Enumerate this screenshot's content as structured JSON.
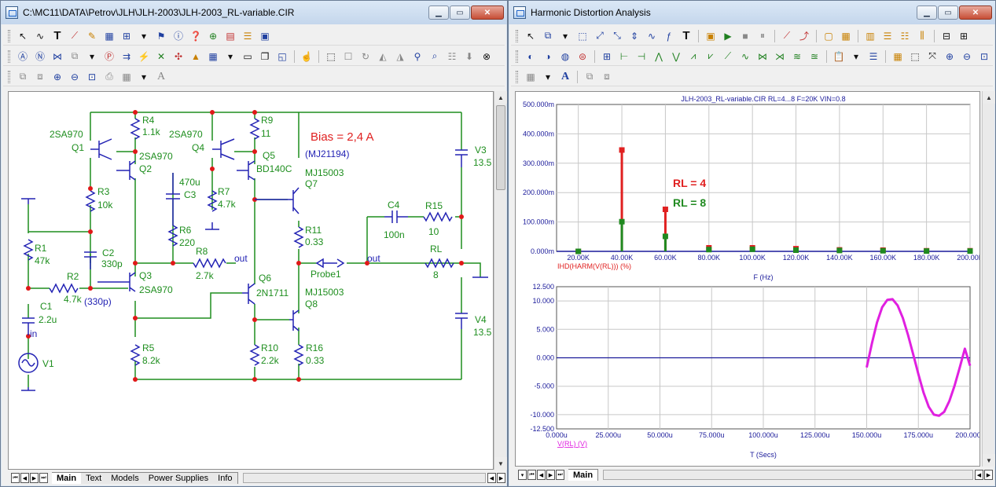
{
  "schematic_window": {
    "title": "C:\\MC11\\DATA\\Petrov\\JLH\\JLH-2003\\JLH-2003_RL-variable.CIR",
    "tabs": [
      {
        "label": "Main",
        "active": true
      },
      {
        "label": "Text",
        "active": false
      },
      {
        "label": "Models",
        "active": false
      },
      {
        "label": "Power Supplies",
        "active": false
      },
      {
        "label": "Info",
        "active": false
      }
    ],
    "bias_label": "Bias = 2,4 A",
    "components": {
      "r4": "R4",
      "r4v": "1.1k",
      "q1t": "2SA970",
      "q1": "Q1",
      "q2t": "2SA970",
      "q2": "Q2",
      "q4t": "2SA970",
      "q4": "Q4",
      "r9": "R9",
      "r9v": "11",
      "q5": "Q5",
      "q5t": "BD140C",
      "mj21194": "(MJ21194)",
      "q7t": "MJ15003",
      "q7": "Q7",
      "c3v": "470u",
      "c3": "C3",
      "r7": "R7",
      "r7v": "4.7k",
      "r3": "R3",
      "r3v": "10k",
      "r6": "R6",
      "r6v": "220",
      "v3": "V3",
      "v3v": "13.5",
      "c4": "C4",
      "c4v": "100n",
      "r15": "R15",
      "r15v": "10",
      "r11": "R11",
      "r11v": "0.33",
      "r1": "R1",
      "r1v": "47k",
      "c2": "C2",
      "c2v": "330p",
      "r8": "R8",
      "r8v": "2.7k",
      "out1": "out",
      "out2": "out",
      "rl": "RL",
      "rlv": "8",
      "probe": "Probe1",
      "r2": "R2",
      "r2v": "4.7k",
      "q3": "Q3",
      "q3t": "2SA970",
      "p330": "(330p)",
      "q6": "Q6",
      "q6t": "2N1711",
      "q8t": "MJ15003",
      "q8": "Q8",
      "c1": "C1",
      "c1v": "2.2u",
      "in": "in",
      "v4": "V4",
      "v4v": "13.5",
      "r5": "R5",
      "r5v": "8.2k",
      "r10": "R10",
      "r10v": "2.2k",
      "r16": "R16",
      "r16v": "0.33",
      "v1": "V1"
    }
  },
  "analysis_window": {
    "title": "Harmonic Distortion Analysis",
    "tabs": [
      {
        "label": "Main",
        "active": true
      }
    ]
  },
  "colors": {
    "red": "#e02020",
    "green": "#208a20",
    "magenta": "#e020e0",
    "axis": "#1a1a9a",
    "wire": "#1e8e1e",
    "symbol": "#2323b4"
  },
  "chart_data": [
    {
      "type": "bar",
      "title": "JLH-2003_RL-variable.CIR RL=4...8 F=20K VIN=0.8",
      "xlabel": "F (Hz)",
      "trace_label": "IHD(HARM(V(RL))) (%)",
      "xlim": [
        10000,
        200000
      ],
      "ylim": [
        0,
        0.5
      ],
      "x_ticks": [
        "20.00K",
        "40.00K",
        "60.00K",
        "80.00K",
        "100.00K",
        "120.00K",
        "140.00K",
        "160.00K",
        "180.00K",
        "200.00K"
      ],
      "y_ticks": [
        "0.000m",
        "100.000m",
        "200.000m",
        "300.000m",
        "400.000m",
        "500.000m"
      ],
      "annotations": [
        "RL = 4",
        "RL = 8"
      ],
      "grid": true,
      "series": [
        {
          "name": "RL = 4",
          "color": "#e02020",
          "x": [
            20000,
            40000,
            60000,
            80000,
            100000,
            120000,
            140000,
            160000,
            180000,
            200000
          ],
          "values": [
            0.0,
            0.345,
            0.143,
            0.012,
            0.012,
            0.009,
            0.005,
            0.004,
            0.002,
            0.002
          ]
        },
        {
          "name": "RL = 8",
          "color": "#208a20",
          "x": [
            20000,
            40000,
            60000,
            80000,
            100000,
            120000,
            140000,
            160000,
            180000,
            200000
          ],
          "values": [
            0.0,
            0.101,
            0.051,
            0.006,
            0.007,
            0.004,
            0.003,
            0.002,
            0.001,
            0.001
          ]
        }
      ]
    },
    {
      "type": "line",
      "xlabel": "T (Secs)",
      "trace_label": "V(RL) (V)",
      "xlim": [
        0,
        0.0002
      ],
      "ylim": [
        -12.5,
        12.5
      ],
      "x_ticks": [
        "0.000u",
        "25.000u",
        "50.000u",
        "75.000u",
        "100.000u",
        "125.000u",
        "150.000u",
        "175.000u",
        "200.000u"
      ],
      "y_ticks": [
        "-12.500",
        "-10.000",
        "-5.000",
        "0.000",
        "5.000",
        "10.000",
        "12.500"
      ],
      "grid": true,
      "series": [
        {
          "name": "V(RL)",
          "color": "#e020e0",
          "x": [
            0.00015,
            0.0001525,
            0.000155,
            0.0001575,
            0.00016,
            0.0001625,
            0.000165,
            0.0001675,
            0.00017,
            0.0001725,
            0.000175,
            0.0001775,
            0.00018,
            0.0001825,
            0.000185,
            0.0001875,
            0.00019,
            0.0001925,
            0.000195,
            0.0001975,
            0.0002
          ],
          "values": [
            -1.7,
            2.5,
            6.2,
            8.9,
            10.2,
            10.3,
            9.2,
            7.0,
            4.0,
            0.6,
            -2.9,
            -6.1,
            -8.6,
            -10.0,
            -10.2,
            -9.5,
            -7.6,
            -4.9,
            -1.7,
            1.6,
            -1.4
          ]
        }
      ]
    }
  ]
}
